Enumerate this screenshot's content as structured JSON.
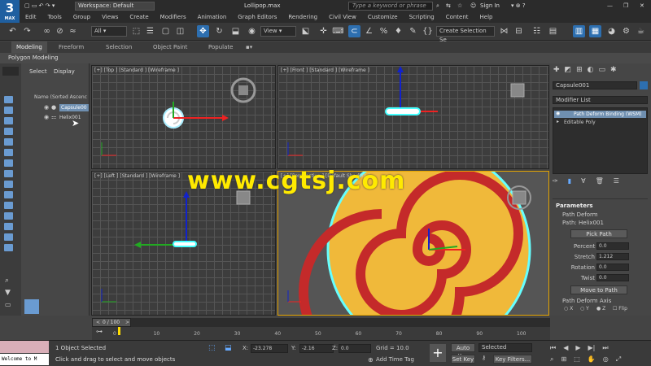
{
  "title": {
    "workspace": "Workspace: Default",
    "filename": "Lollipop.max",
    "search_placeholder": "Type a keyword or phrase",
    "sign_in": "Sign In"
  },
  "logo": {
    "num": "3",
    "sub": "MAX"
  },
  "menu": [
    "Edit",
    "Tools",
    "Group",
    "Views",
    "Create",
    "Modifiers",
    "Animation",
    "Graph Editors",
    "Rendering",
    "Civil View",
    "Customize",
    "Scripting",
    "Content",
    "Help"
  ],
  "toolbar": {
    "filter": "All",
    "refsys": "View",
    "selset": "Create Selection Se"
  },
  "ribbon": {
    "tabs": [
      "Modeling",
      "Freeform",
      "Selection",
      "Object Paint",
      "Populate"
    ],
    "subtab": "Polygon Modeling"
  },
  "scene": {
    "tabs": [
      "Select",
      "Display"
    ],
    "header": "Name (Sorted Ascenc",
    "items": [
      "Capsule00",
      "Helix001"
    ]
  },
  "viewports": {
    "top": "[+] [Top ] [Standard ] [Wireframe ]",
    "front": "[+] [Front ] [Standard ] [Wireframe ]",
    "left": "[+] [Left ] [Standard ] [Wireframe ]",
    "persp": "[+] [Perspective ] [Default Shading ]"
  },
  "watermark": "www.cgtsj.com",
  "cmdpanel": {
    "object_name": "Capsule001",
    "modifier_list": "Modifier List",
    "stack": [
      "Path Deform Binding (WSM)",
      "Editable Poly"
    ],
    "params_title": "Parameters",
    "path_deform": "Path Deform",
    "path": "Path: Helix001",
    "pick_path": "Pick Path",
    "percent_label": "Percent",
    "percent": "0.0",
    "stretch_label": "Stretch",
    "stretch": "1.212",
    "rotation_label": "Rotation",
    "rotation": "0.0",
    "twist_label": "Twist",
    "twist": "0.0",
    "move_to_path": "Move to Path",
    "axis_label": "Path Deform Axis",
    "axes": [
      "X",
      "Y",
      "Z",
      "Flip"
    ]
  },
  "timeline": {
    "frame": "0 / 100",
    "ticks": [
      "0",
      "10",
      "20",
      "30",
      "40",
      "50",
      "60",
      "70",
      "80",
      "90",
      "100"
    ]
  },
  "status": {
    "welcome": "Welcome to M",
    "selected": "1 Object Selected",
    "hint": "Click and drag to select and move objects",
    "x_label": "X:",
    "x": "-23.278",
    "y_label": "Y:",
    "y": "-2.16",
    "z_label": "Z:",
    "z": "0.0",
    "grid": "Grid = 10.0",
    "add_time_tag": "Add Time Tag",
    "auto_key": "Auto Key",
    "set_key": "Set Key",
    "selected_dd": "Selected",
    "key_filters": "Key Filters..."
  },
  "colors": {
    "accent": "#2d6fb0",
    "active_viewport": "#e5a400",
    "candy_yellow": "#f0b93a",
    "candy_red": "#c42a2a"
  }
}
